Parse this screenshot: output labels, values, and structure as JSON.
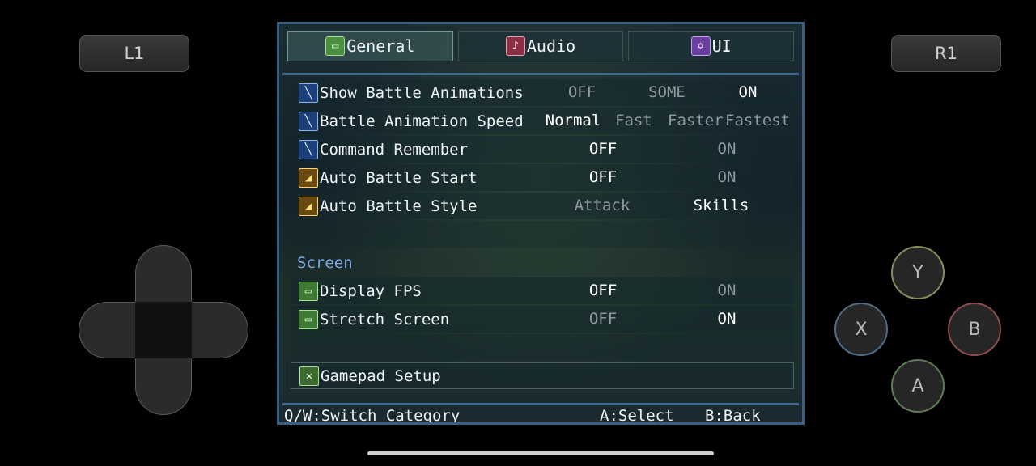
{
  "controller": {
    "l1": "L1",
    "r1": "R1",
    "face": {
      "y": "Y",
      "x": "X",
      "b": "B",
      "a": "A"
    }
  },
  "tabs": [
    {
      "label": "General",
      "icon": "monitor-icon",
      "active": true
    },
    {
      "label": "Audio",
      "icon": "music-note-icon",
      "active": false
    },
    {
      "label": "UI",
      "icon": "hexagram-icon",
      "active": false
    }
  ],
  "settings": {
    "show_battle_animations": {
      "label": "Show Battle Animations",
      "options": [
        "OFF",
        "SOME",
        "ON"
      ],
      "selected": "ON"
    },
    "battle_animation_speed": {
      "label": "Battle Animation Speed",
      "options": [
        "Normal",
        "Fast",
        "Faster",
        "Fastest"
      ],
      "selected": "Normal"
    },
    "command_remember": {
      "label": "Command Remember",
      "options": [
        "OFF",
        "ON"
      ],
      "selected": "OFF"
    },
    "auto_battle_start": {
      "label": "Auto Battle Start",
      "options": [
        "OFF",
        "ON"
      ],
      "selected": "OFF"
    },
    "auto_battle_style": {
      "label": "Auto Battle Style",
      "options": [
        "Attack",
        "Skills"
      ],
      "selected": "Skills"
    },
    "screen_section": "Screen",
    "display_fps": {
      "label": "Display FPS",
      "options": [
        "OFF",
        "ON"
      ],
      "selected": "OFF"
    },
    "stretch_screen": {
      "label": "Stretch Screen",
      "options": [
        "OFF",
        "ON"
      ],
      "selected": "ON"
    },
    "gamepad_setup": {
      "label": "Gamepad Setup"
    }
  },
  "footer": {
    "switch": "Q/W:Switch Category",
    "select": "A:Select",
    "back": "B:Back"
  },
  "colors": {
    "frame_border": "#3a5f82",
    "selected_text": "#ffffff",
    "unselected_text": "#8e9aa0",
    "section_text": "#7fa6e0"
  }
}
